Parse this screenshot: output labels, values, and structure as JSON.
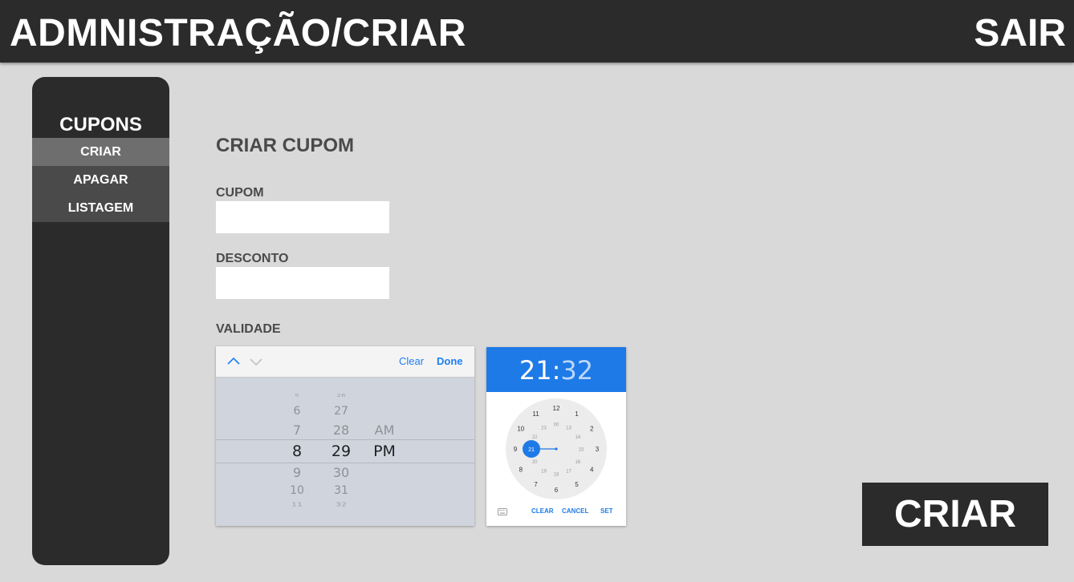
{
  "header": {
    "title": "ADMNISTRAÇÃO/CRIAR",
    "logout_label": "SAIR"
  },
  "sidebar": {
    "section_title": "CUPONS",
    "items": [
      {
        "label": "CRIAR",
        "active": true
      },
      {
        "label": "APAGAR",
        "active": false
      },
      {
        "label": "LISTAGEM",
        "active": false
      }
    ]
  },
  "form": {
    "title": "CRIAR CUPOM",
    "coupon_label": "CUPOM",
    "coupon_value": "",
    "discount_label": "DESCONTO",
    "discount_value": "",
    "validity_label": "VALIDADE"
  },
  "date_picker": {
    "clear_label": "Clear",
    "done_label": "Done",
    "hours": [
      "5",
      "6",
      "7",
      "8",
      "9",
      "10",
      "11"
    ],
    "minutes": [
      "26",
      "27",
      "28",
      "29",
      "30",
      "31",
      "32"
    ],
    "periods": [
      "AM",
      "PM"
    ],
    "selected_hour": "8",
    "selected_minute": "29",
    "selected_period": "PM"
  },
  "clock_picker": {
    "hour": "21",
    "separator": ":",
    "minute": "32",
    "outer_numbers": [
      "12",
      "1",
      "2",
      "3",
      "4",
      "5",
      "6",
      "7",
      "8",
      "9",
      "10",
      "11"
    ],
    "inner_numbers": [
      "00",
      "13",
      "14",
      "15",
      "16",
      "17",
      "18",
      "19",
      "20",
      "21",
      "22",
      "23"
    ],
    "selected": "21",
    "clear_label": "CLEAR",
    "cancel_label": "CANCEL",
    "set_label": "SET",
    "accent_color": "#1e7ae6"
  },
  "actions": {
    "create_label": "CRIAR"
  },
  "colors": {
    "dark": "#2b2b2b",
    "background": "#d9d9d9",
    "active_nav": "#6e6e6e",
    "nav": "#4a4a4a",
    "link_blue": "#1c7ef2"
  }
}
